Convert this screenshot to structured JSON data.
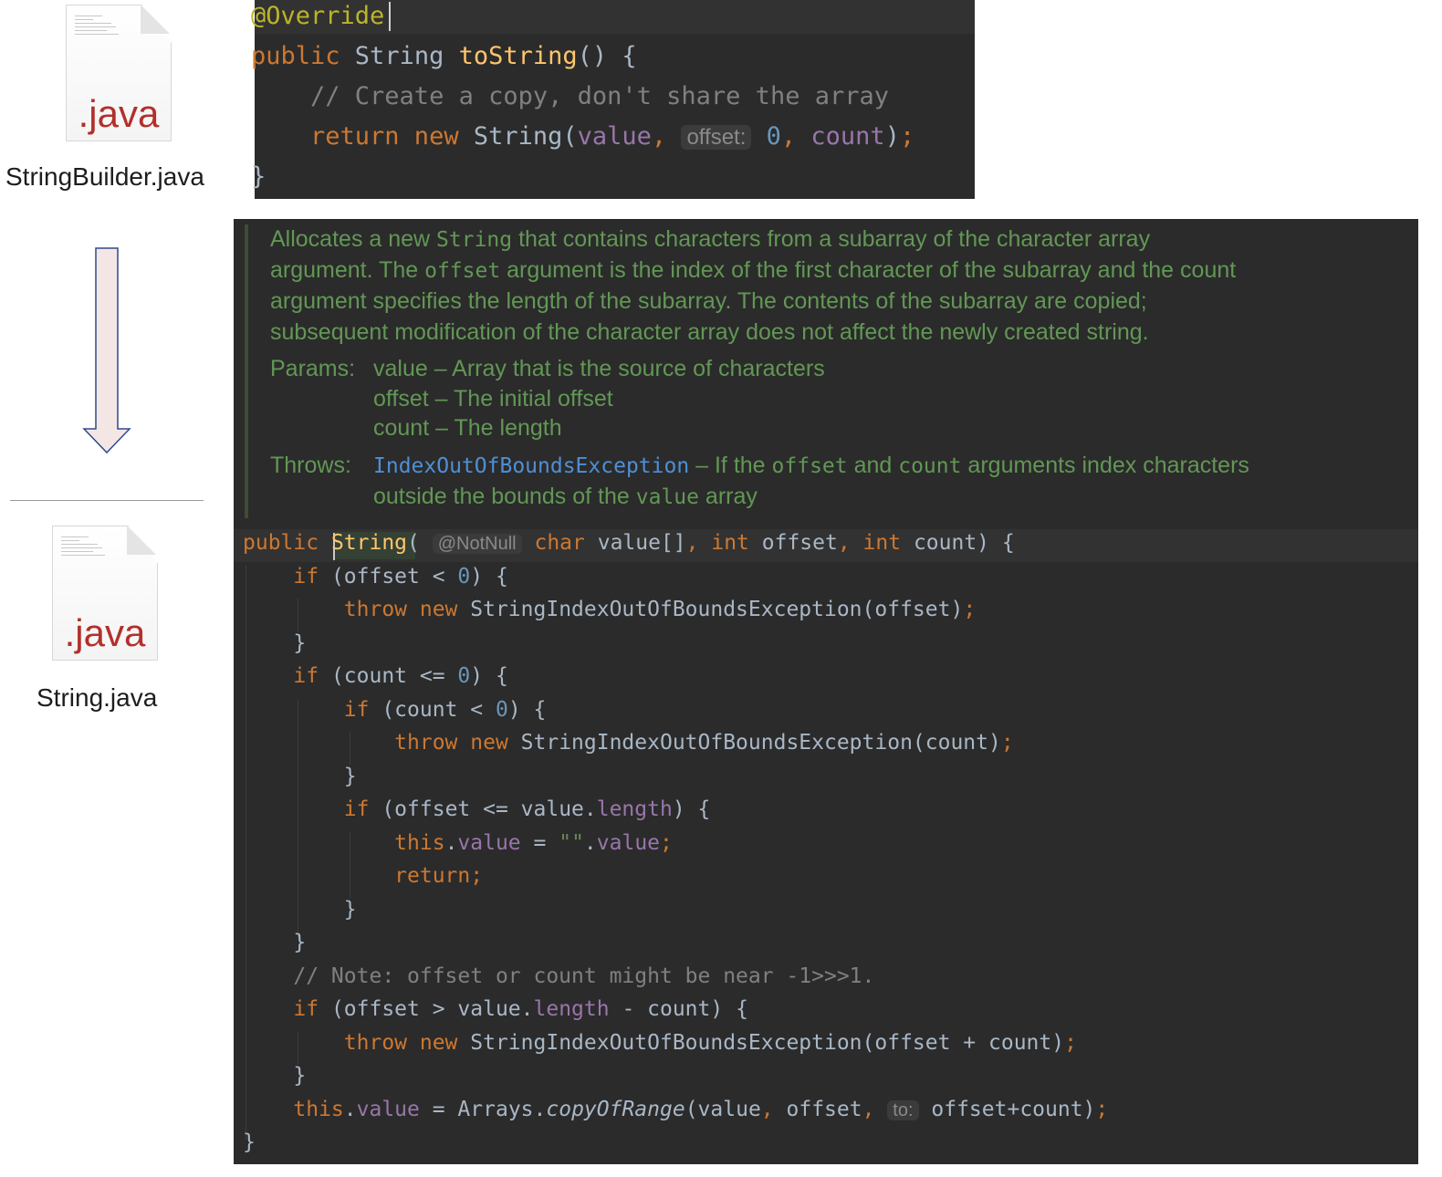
{
  "files": {
    "top": {
      "extension": ".java",
      "name": "StringBuilder.java"
    },
    "bottom": {
      "extension": ".java",
      "name": "String.java"
    }
  },
  "arrow": {
    "direction": "down",
    "fill": "#f5e6e6",
    "stroke": "#2f4a8a"
  },
  "top_code": {
    "lines": [
      [
        {
          "t": "@Override",
          "c": "ann"
        }
      ],
      [
        {
          "t": "public",
          "c": "kw"
        },
        {
          "t": " String ",
          "c": ""
        },
        {
          "t": "toString",
          "c": "fn"
        },
        {
          "t": "() {",
          "c": ""
        }
      ],
      [
        {
          "t": "    // Create a copy, don't share the array",
          "c": "cm"
        }
      ],
      [
        {
          "t": "    return new ",
          "c": "kw"
        },
        {
          "t": "String(",
          "c": ""
        },
        {
          "t": "value",
          "c": "fld"
        },
        {
          "t": ", ",
          "c": "kw"
        },
        {
          "t": "offset:",
          "c": "hint"
        },
        {
          "t": " 0",
          "c": "num"
        },
        {
          "t": ", ",
          "c": "kw"
        },
        {
          "t": "count",
          "c": "fld"
        },
        {
          "t": ")",
          "c": ""
        },
        {
          "t": ";",
          "c": "kw"
        }
      ],
      [
        {
          "t": "}",
          "c": ""
        }
      ]
    ]
  },
  "javadoc": {
    "description": [
      [
        {
          "t": "Allocates a new ",
          "m": false
        },
        {
          "t": "String",
          "m": true
        },
        {
          "t": " that contains characters from a subarray of the character array",
          "m": false
        }
      ],
      [
        {
          "t": "argument. The ",
          "m": false
        },
        {
          "t": "offset",
          "m": true
        },
        {
          "t": " argument is the index of the first character of the subarray and the count",
          "m": false
        }
      ],
      [
        {
          "t": "argument specifies the length of the subarray. The contents of the subarray are copied;",
          "m": false
        }
      ],
      [
        {
          "t": "subsequent modification of the character array does not affect the newly created string.",
          "m": false
        }
      ]
    ],
    "params_label": "Params:",
    "params": [
      "value – Array that is the source of characters",
      "offset – The initial offset",
      "count – The length"
    ],
    "throws_label": "Throws:",
    "throws_link": "IndexOutOfBoundsException",
    "throws_line1": [
      {
        "t": " – If the ",
        "m": false
      },
      {
        "t": "offset",
        "m": true
      },
      {
        "t": " and ",
        "m": false
      },
      {
        "t": "count",
        "m": true
      },
      {
        "t": " arguments index characters",
        "m": false
      }
    ],
    "throws_line2": [
      {
        "t": "outside the bounds of the ",
        "m": false
      },
      {
        "t": "value",
        "m": true
      },
      {
        "t": " array",
        "m": false
      }
    ]
  },
  "main_code": {
    "lines": [
      [
        {
          "t": "public ",
          "c": "kw"
        },
        {
          "t": "String",
          "c": "fn"
        },
        {
          "t": "( ",
          "c": ""
        },
        {
          "t": "@NotNull",
          "c": "hint"
        },
        {
          "t": " char ",
          "c": "kw"
        },
        {
          "t": "value[]",
          "c": ""
        },
        {
          "t": ", ",
          "c": "kw"
        },
        {
          "t": "int ",
          "c": "kw"
        },
        {
          "t": "offset",
          "c": ""
        },
        {
          "t": ", ",
          "c": "kw"
        },
        {
          "t": "int ",
          "c": "kw"
        },
        {
          "t": "count) {",
          "c": ""
        }
      ],
      [
        {
          "t": "    ",
          "c": ""
        },
        {
          "t": "if ",
          "c": "kw"
        },
        {
          "t": "(offset < ",
          "c": ""
        },
        {
          "t": "0",
          "c": "num"
        },
        {
          "t": ") {",
          "c": ""
        }
      ],
      [
        {
          "t": "        ",
          "c": ""
        },
        {
          "t": "throw new ",
          "c": "kw"
        },
        {
          "t": "StringIndexOutOfBoundsException(offset)",
          "c": ""
        },
        {
          "t": ";",
          "c": "kw"
        }
      ],
      [
        {
          "t": "    }",
          "c": ""
        }
      ],
      [
        {
          "t": "    ",
          "c": ""
        },
        {
          "t": "if ",
          "c": "kw"
        },
        {
          "t": "(count <= ",
          "c": ""
        },
        {
          "t": "0",
          "c": "num"
        },
        {
          "t": ") {",
          "c": ""
        }
      ],
      [
        {
          "t": "        ",
          "c": ""
        },
        {
          "t": "if ",
          "c": "kw"
        },
        {
          "t": "(count < ",
          "c": ""
        },
        {
          "t": "0",
          "c": "num"
        },
        {
          "t": ") {",
          "c": ""
        }
      ],
      [
        {
          "t": "            ",
          "c": ""
        },
        {
          "t": "throw new ",
          "c": "kw"
        },
        {
          "t": "StringIndexOutOfBoundsException(count)",
          "c": ""
        },
        {
          "t": ";",
          "c": "kw"
        }
      ],
      [
        {
          "t": "        }",
          "c": ""
        }
      ],
      [
        {
          "t": "        ",
          "c": ""
        },
        {
          "t": "if ",
          "c": "kw"
        },
        {
          "t": "(offset <= value.",
          "c": ""
        },
        {
          "t": "length",
          "c": "fld"
        },
        {
          "t": ") {",
          "c": ""
        }
      ],
      [
        {
          "t": "            ",
          "c": ""
        },
        {
          "t": "this",
          "c": "kw"
        },
        {
          "t": ".",
          "c": ""
        },
        {
          "t": "value",
          "c": "fld"
        },
        {
          "t": " = ",
          "c": ""
        },
        {
          "t": "\"\"",
          "c": "str"
        },
        {
          "t": ".",
          "c": ""
        },
        {
          "t": "value",
          "c": "fld"
        },
        {
          "t": ";",
          "c": "kw"
        }
      ],
      [
        {
          "t": "            ",
          "c": ""
        },
        {
          "t": "return;",
          "c": "kw"
        }
      ],
      [
        {
          "t": "        }",
          "c": ""
        }
      ],
      [
        {
          "t": "    }",
          "c": ""
        }
      ],
      [
        {
          "t": "    // Note: offset or count might be near -1>>>1.",
          "c": "cm"
        }
      ],
      [
        {
          "t": "    ",
          "c": ""
        },
        {
          "t": "if ",
          "c": "kw"
        },
        {
          "t": "(offset > value.",
          "c": ""
        },
        {
          "t": "length",
          "c": "fld"
        },
        {
          "t": " - count) {",
          "c": ""
        }
      ],
      [
        {
          "t": "        ",
          "c": ""
        },
        {
          "t": "throw new ",
          "c": "kw"
        },
        {
          "t": "StringIndexOutOfBoundsException(offset + count)",
          "c": ""
        },
        {
          "t": ";",
          "c": "kw"
        }
      ],
      [
        {
          "t": "    }",
          "c": ""
        }
      ],
      [
        {
          "t": "    ",
          "c": ""
        },
        {
          "t": "this",
          "c": "kw"
        },
        {
          "t": ".",
          "c": ""
        },
        {
          "t": "value",
          "c": "fld"
        },
        {
          "t": " = Arrays.",
          "c": ""
        },
        {
          "t": "copyOfRange",
          "c": "it"
        },
        {
          "t": "(value",
          "c": ""
        },
        {
          "t": ", ",
          "c": "kw"
        },
        {
          "t": "offset",
          "c": ""
        },
        {
          "t": ", ",
          "c": "kw"
        },
        {
          "t": "to:",
          "c": "hint"
        },
        {
          "t": " offset+count)",
          "c": ""
        },
        {
          "t": ";",
          "c": "kw"
        }
      ],
      [
        {
          "t": "}",
          "c": ""
        }
      ]
    ]
  }
}
